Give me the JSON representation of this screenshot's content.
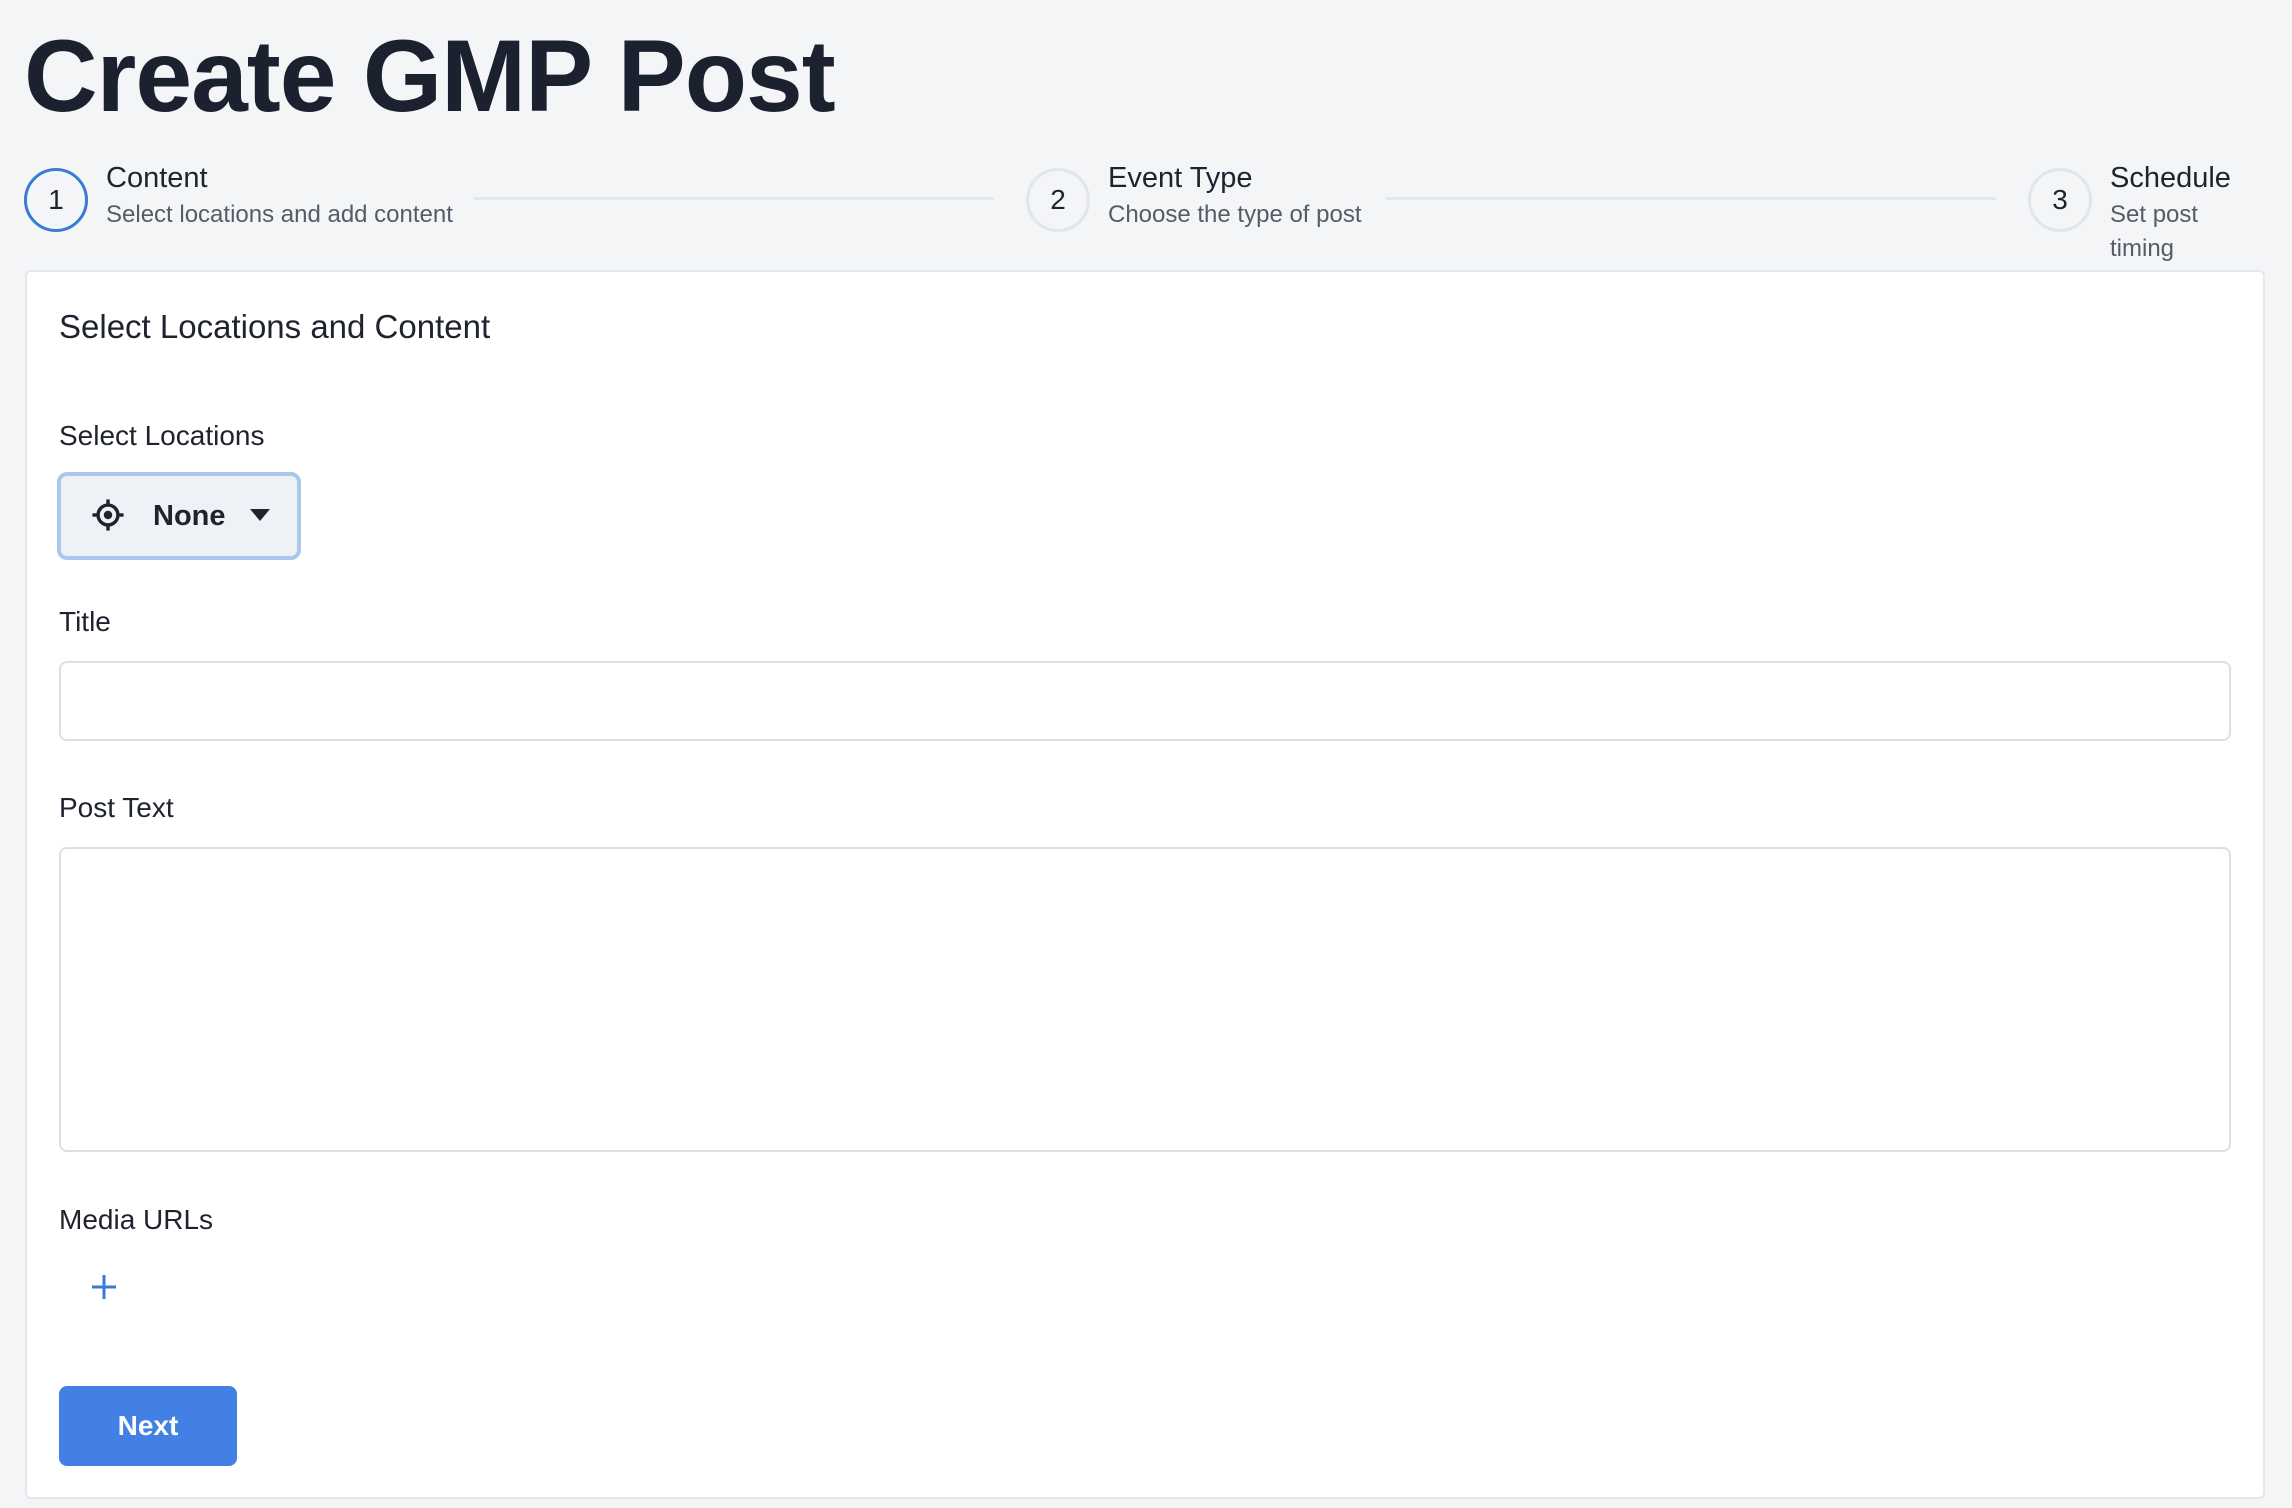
{
  "page": {
    "title": "Create GMP Post"
  },
  "stepper": {
    "steps": [
      {
        "number": "1",
        "title": "Content",
        "subtitle": "Select locations and add content",
        "active": true
      },
      {
        "number": "2",
        "title": "Event Type",
        "subtitle": "Choose the type of post",
        "active": false
      },
      {
        "number": "3",
        "title": "Schedule",
        "subtitle": "Set post timing",
        "active": false
      }
    ]
  },
  "form": {
    "card_title": "Select Locations and Content",
    "locations": {
      "label": "Select Locations",
      "value": "None",
      "icon": "crosshair-icon"
    },
    "title_field": {
      "label": "Title",
      "value": "",
      "placeholder": ""
    },
    "post_text": {
      "label": "Post Text",
      "value": "",
      "placeholder": ""
    },
    "media_urls": {
      "label": "Media URLs",
      "add_icon": "plus-icon"
    },
    "next_label": "Next"
  },
  "colors": {
    "accent": "#4280e4",
    "active_step_border": "#3d7ad6",
    "select_focus_border": "#a9c8ec",
    "page_background": "#f4f5f7"
  }
}
